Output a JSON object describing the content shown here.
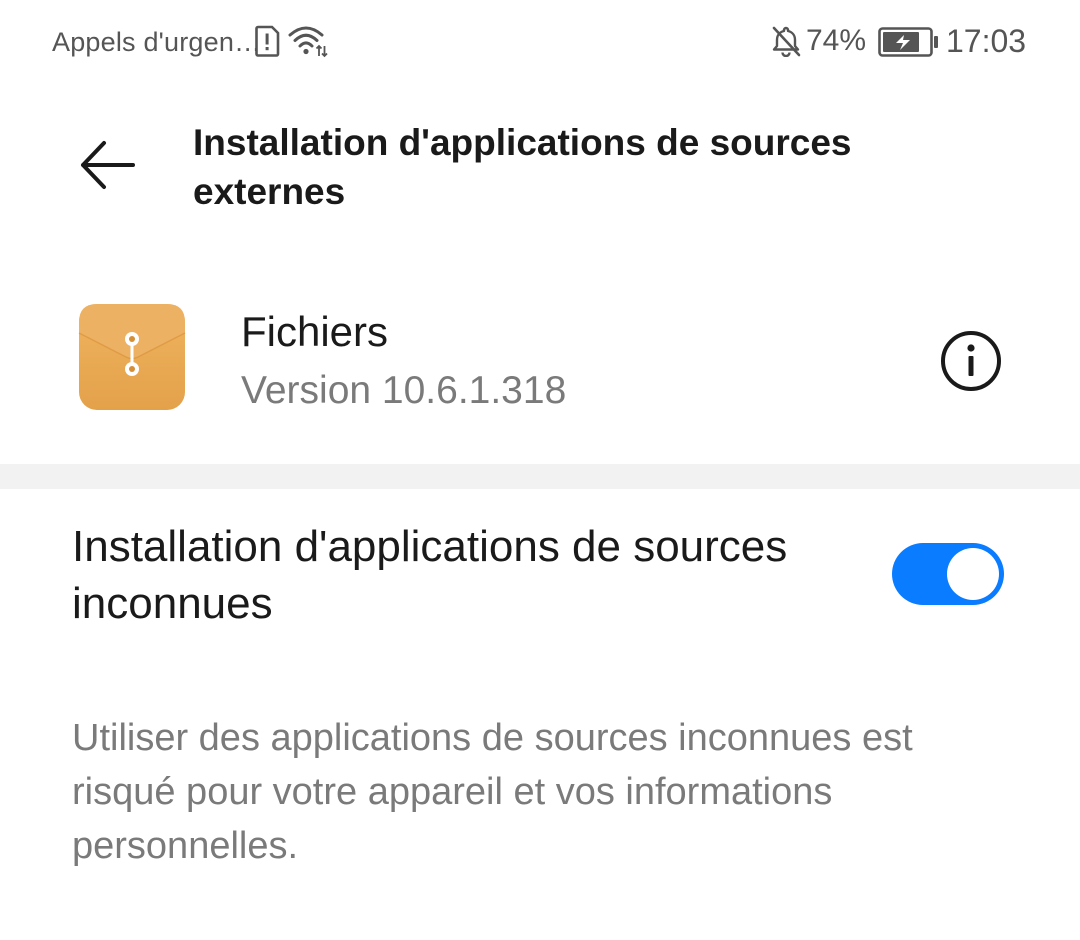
{
  "status_bar": {
    "carrier": "Appels d'urgen…",
    "battery_percent": "74%",
    "time": "17:03",
    "icons": [
      "sim-alert-icon",
      "wifi-icon",
      "notifications-muted-icon",
      "battery-charging-icon"
    ]
  },
  "header": {
    "back_icon": "arrow-left-icon",
    "title": "Installation d'applications de sources externes"
  },
  "app": {
    "icon": "files-app-icon",
    "name": "Fichiers",
    "version": "Version 10.6.1.318",
    "info_icon": "info-icon"
  },
  "setting": {
    "label": "Installation d'applications de sources inconnues",
    "enabled": true
  },
  "warning": "Utiliser des applications de sources inconnues est risqué pour votre appareil et vos informations personnelles.",
  "colors": {
    "accent": "#0a7cff",
    "text_primary": "#1a1a1a",
    "text_secondary": "#7a7a7a",
    "divider": "#f2f2f2",
    "app_icon": "#e9a94f"
  }
}
